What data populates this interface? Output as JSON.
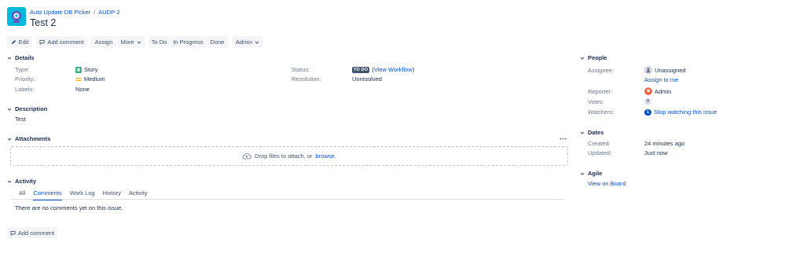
{
  "header": {
    "project_name": "Auto Update DB Picker",
    "issue_key": "AUDP-2",
    "breadcrumb_separator": "/",
    "title": "Test 2"
  },
  "toolbar": {
    "edit": "Edit",
    "add_comment": "Add comment",
    "assign": "Assign",
    "more": "More",
    "to_do": "To Do",
    "in_progress": "In Progress",
    "done": "Done",
    "admin": "Admin"
  },
  "details": {
    "heading": "Details",
    "type_label": "Type:",
    "type_value": "Story",
    "priority_label": "Priority:",
    "priority_value": "Medium",
    "labels_label": "Labels:",
    "labels_value": "None",
    "status_label": "Status:",
    "status_value": "TO DO",
    "view_workflow": "View Workflow",
    "resolution_label": "Resolution:",
    "resolution_value": "Unresolved"
  },
  "description": {
    "heading": "Description",
    "text": "Test"
  },
  "attachments": {
    "heading": "Attachments",
    "more_icon": "ellipsis-icon",
    "drop_text": "Drop files to attach, or",
    "browse": "browse."
  },
  "activity": {
    "heading": "Activity",
    "tabs": [
      "All",
      "Comments",
      "Work Log",
      "History",
      "Activity"
    ],
    "active_tab": "Comments",
    "empty_text": "There are no comments yet on this issue.",
    "add_comment": "Add comment"
  },
  "people": {
    "heading": "People",
    "assignee_label": "Assignee:",
    "assignee_value": "Unassigned",
    "assign_to_me": "Assign to me",
    "reporter_label": "Reporter:",
    "reporter_value": "Admin",
    "votes_label": "Votes:",
    "votes_value": "0",
    "watchers_label": "Watchers:",
    "watchers_value": "1",
    "stop_watching": "Stop watching this issue"
  },
  "dates": {
    "heading": "Dates",
    "created_label": "Created:",
    "created_value": "24 minutes ago",
    "updated_label": "Updated:",
    "updated_value": "Just now"
  },
  "agile": {
    "heading": "Agile",
    "view_on_board": "View on Board"
  },
  "colors": {
    "link": "#0052cc",
    "text": "#172b4d",
    "muted": "#6b778c",
    "button_bg": "#f4f5f7",
    "story_green": "#36b37e",
    "priority_yellow": "#ffab00",
    "project_teal": "#00b8d9"
  }
}
